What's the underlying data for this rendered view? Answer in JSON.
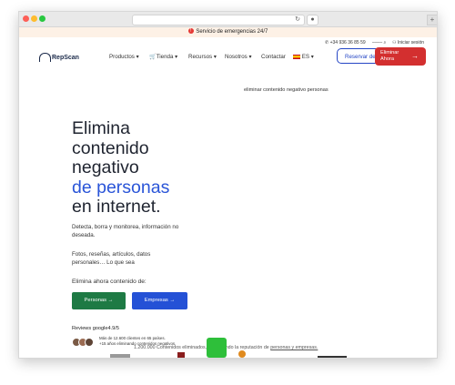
{
  "browser": {
    "reload_glyph": "↻",
    "ext_glyph": "●",
    "newtab_glyph": "+"
  },
  "banner": {
    "text": "Servicio de emergencias 24/7",
    "alert_glyph": "!"
  },
  "topbar": {
    "phone": "+34 936 36 85 59",
    "login": "Iniciar sesión"
  },
  "header": {
    "brand": "RepScan",
    "nav": [
      {
        "label": "Productos"
      },
      {
        "label": "Tienda"
      },
      {
        "label": "Recursos"
      },
      {
        "label": "Nosotros"
      },
      {
        "label": "Contactar"
      },
      {
        "label": "ES"
      }
    ],
    "reservar_label": "Reservar demo",
    "eliminar_label_1": "Eliminar",
    "eliminar_label_2": "Ahora"
  },
  "hero": {
    "rotating_text": "eliminar contenido negativo personas",
    "title_line1": "Elimina",
    "title_line2": "contenido",
    "title_line3": "negativo",
    "title_line4_blue": "de personas",
    "title_line5": "en internet.",
    "desc_line1": "Detecta, borra y monitorea, información no",
    "desc_line2": "deseada.",
    "desc_line3": "Fotos, reseñas, artículos, datos",
    "desc_line4": "personales… Lo que sea",
    "elimina_label": "Elimina ahora contenido de:",
    "btn_personas": "Personas →",
    "btn_empresas": "Empresas →"
  },
  "social_proof": {
    "reviews": "Reviews google4.9/5",
    "clients_line1": "Más de 12.600 clientes en 65 países.",
    "clients_line2": "+15 años eliminando contenidos negativos.",
    "protect_text": "1.200.000 Contenidos eliminados, protegiendo la reputación de",
    "protect_link": "personas y empresas."
  },
  "colors": {
    "accent_blue": "#2a55d8",
    "accent_red": "#d32f2f",
    "accent_green": "#1e7a44"
  }
}
